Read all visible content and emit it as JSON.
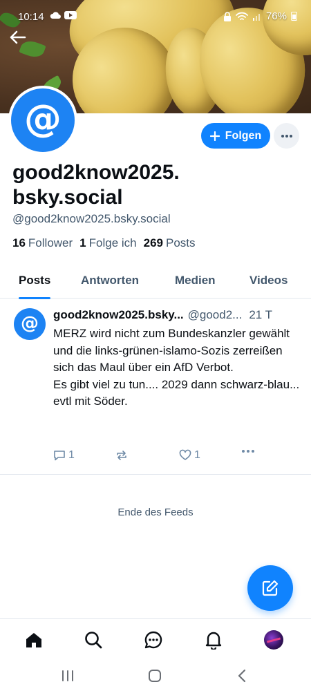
{
  "status_bar": {
    "time": "10:14",
    "battery": "76%"
  },
  "profile": {
    "display_name": "good2know2025.bsky.social",
    "handle": "@good2know2025.bsky.social",
    "avatar_glyph": "@",
    "follow_button": "Folgen",
    "stats": {
      "followers_count": "16",
      "followers_label": "Follower",
      "following_count": "1",
      "following_label": "Folge ich",
      "posts_count": "269",
      "posts_label": "Posts"
    }
  },
  "tabs": [
    {
      "label": "Posts",
      "active": true
    },
    {
      "label": "Antworten",
      "active": false
    },
    {
      "label": "Medien",
      "active": false
    },
    {
      "label": "Videos",
      "active": false
    }
  ],
  "post": {
    "author_name": "good2know2025.bsky...",
    "author_handle": "@good2...",
    "time": "21 T",
    "text": "MERZ wird nicht zum Bundeskanzler gewählt\nund die links-grünen-islamo-Sozis zerreißen sich das Maul über ein AfD Verbot.\nEs gibt viel zu tun.... 2029 dann schwarz-blau... evtl mit Söder.",
    "reply_count": "1",
    "like_count": "1"
  },
  "feed_end": "Ende des Feeds",
  "colors": {
    "accent": "#1083fe",
    "text_primary": "#0b0f14",
    "text_secondary": "#42576c"
  },
  "icons": {
    "back": "arrow-left-icon",
    "compose": "edit-icon",
    "nav": [
      "home-icon",
      "search-icon",
      "chat-icon",
      "bell-icon",
      "profile-avatar"
    ]
  }
}
